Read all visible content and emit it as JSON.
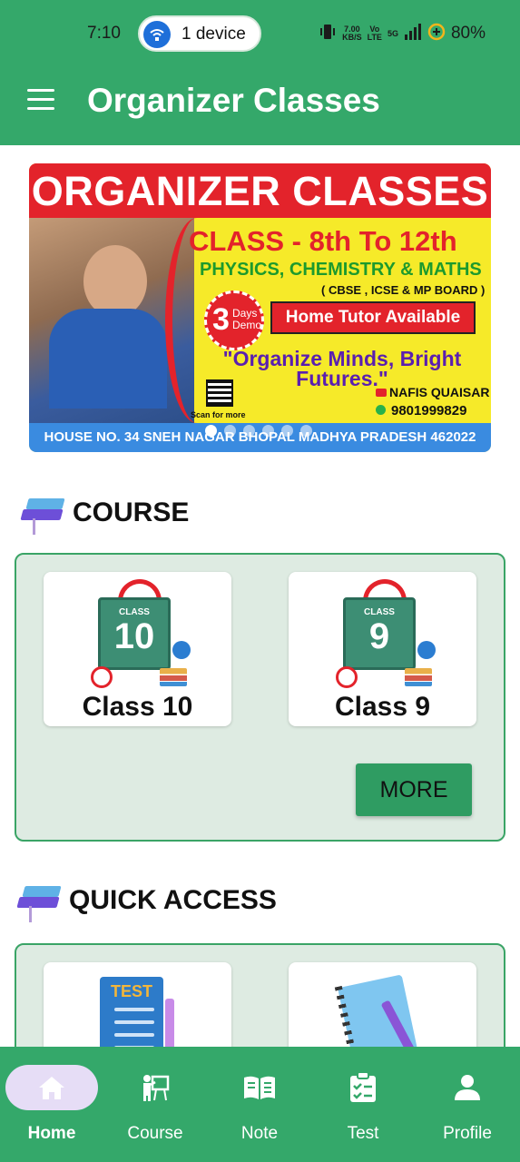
{
  "status_bar": {
    "time": "7:10",
    "hotspot_label": "1 device",
    "network_speed_top": "7.00",
    "network_speed_bottom": "KB/S",
    "volte_top": "Vo",
    "volte_bottom": "LTE",
    "network_type": "5G",
    "battery": "80%"
  },
  "app_bar": {
    "title": "Organizer Classes",
    "menu_icon": "hamburger-menu-icon"
  },
  "banner": {
    "heading": "ORGANIZER CLASSES",
    "class_range": "CLASS - 8th To 12th",
    "subjects": "PHYSICS, CHEMISTRY & MATHS",
    "boards": "( CBSE , ICSE & MP BOARD )",
    "demo_number": "3",
    "demo_label_1": "Days",
    "demo_label_2": "Demo",
    "tutor": "Home Tutor Available",
    "quote": "\"Organize Minds, Bright Futures.\"",
    "scan": "Scan for more",
    "youtube": "NAFIS QUAISAR",
    "phone": "9801999829",
    "address": "HOUSE NO. 34 SNEH NAGAR BHOPAL MADHYA PRADESH  462022",
    "slide_count": 6,
    "active_slide": 1
  },
  "course_section": {
    "title": "COURSE",
    "cards": [
      {
        "board_word": "CLASS",
        "board_number": "10",
        "label": "Class 10"
      },
      {
        "board_word": "CLASS",
        "board_number": "9",
        "label": "Class 9"
      }
    ],
    "more_label": "MORE"
  },
  "quick_access_section": {
    "title": "QUICK ACCESS",
    "test_art_word": "TEST"
  },
  "bottom_nav": {
    "items": [
      {
        "label": "Home",
        "icon": "home-icon",
        "active": true
      },
      {
        "label": "Course",
        "icon": "teacher-board-icon",
        "active": false
      },
      {
        "label": "Note",
        "icon": "open-book-icon",
        "active": false
      },
      {
        "label": "Test",
        "icon": "checklist-icon",
        "active": false
      },
      {
        "label": "Profile",
        "icon": "person-icon",
        "active": false
      }
    ]
  },
  "colors": {
    "primary": "#34a86a",
    "panel_bg": "#deebe2",
    "active_pill": "#e6ddf6",
    "banner_red": "#e3232b",
    "banner_yellow": "#f6ea29"
  }
}
